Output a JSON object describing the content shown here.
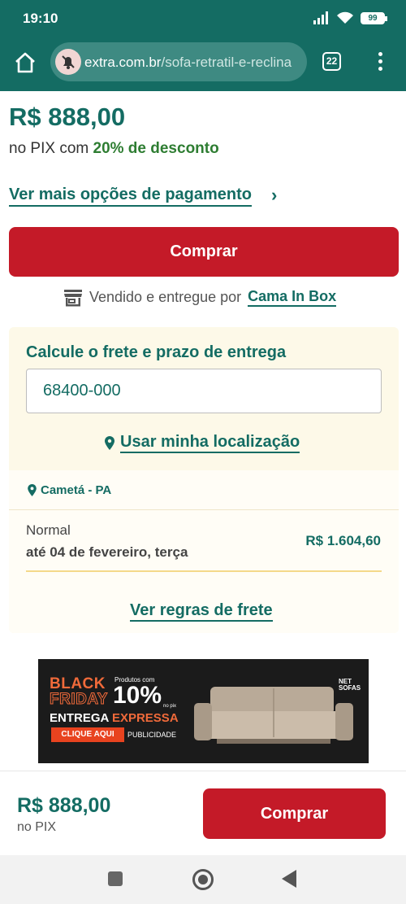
{
  "status": {
    "time": "19:10",
    "battery": "99"
  },
  "browser": {
    "domain": "extra.com.br",
    "path": "/sofa-retratil-e-reclina",
    "tab_count": "22"
  },
  "product": {
    "price": "R$ 888,00",
    "pix_prefix": "no PIX com ",
    "pix_discount": "20% de desconto",
    "more_payment": "Ver mais opções de pagamento",
    "buy_label": "Comprar",
    "seller_prefix": "Vendido e entregue por",
    "seller_name": "Cama In Box"
  },
  "shipping": {
    "title": "Calcule o frete e prazo de entrega",
    "cep_value": "68400-000",
    "use_location": "Usar minha localização",
    "city": "Cametá - PA",
    "option_type": "Normal",
    "option_date": "até 04 de fevereiro, terça",
    "option_price": "R$ 1.604,60",
    "rules_link": "Ver regras de frete"
  },
  "banner": {
    "line1": "BLACK",
    "line2": "FRIDAY",
    "small_top": "Produtos com",
    "percent": "10%",
    "small_pix": "no pix",
    "entrega": "ENTREGA",
    "expressa": "EXPRESSA",
    "cta": "CLIQUE AQUI",
    "pub": "PUBLICIDADE",
    "brand1": "NET",
    "brand2": "SOFAS"
  },
  "sticky": {
    "price": "R$ 888,00",
    "pix": "no PIX",
    "buy_label": "Comprar"
  },
  "colors": {
    "brand_teal": "#146c63",
    "buy_red": "#c41a28",
    "discount_green": "#2e7d32"
  }
}
